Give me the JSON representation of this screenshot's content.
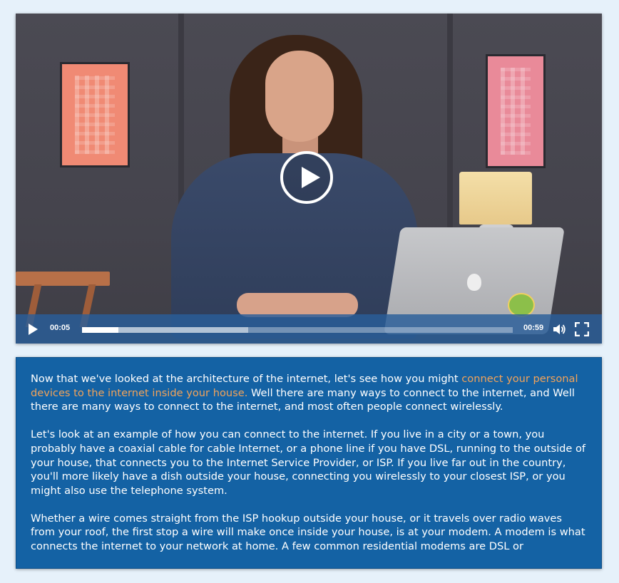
{
  "player": {
    "time_current": "00:05",
    "time_total": "00:59",
    "progress_played_fraction": 0.085,
    "progress_buffered_fraction": 0.385,
    "icons": {
      "big_play": "play-circle-icon",
      "play": "play-icon",
      "volume": "volume-icon",
      "fullscreen": "fullscreen-icon"
    }
  },
  "transcript": {
    "p1_before": "Now that we've looked at the architecture of the internet, let's see how you might ",
    "p1_highlight": "connect your personal devices to the internet inside your house.",
    "p1_after": " Well there are many ways to connect to the internet, and Well there are many ways to connect to the internet, and most often people connect wirelessly.",
    "p2": "Let's look at an example of how you can connect to the internet. If you live in a city or a town, you probably have a coaxial cable for cable Internet, or a phone line if you have DSL, running to the outside of your house, that connects you to the Internet Service Provider, or ISP. If you live far out in the country, you'll more likely have a dish outside your house, connecting you wirelessly to your closest ISP, or you might also use the telephone system.",
    "p3": "Whether a wire comes straight from the ISP hookup outside your house, or it travels over radio waves from your roof, the first stop a wire will make once inside your house, is at your modem. A modem is what connects the internet to your network at home. A few common residential modems are DSL or"
  },
  "colors": {
    "page_background": "#e6f1fa",
    "transcript_background": "#1462a4",
    "highlight": "#f2a35a",
    "control_bar": "#2a5e9a"
  }
}
